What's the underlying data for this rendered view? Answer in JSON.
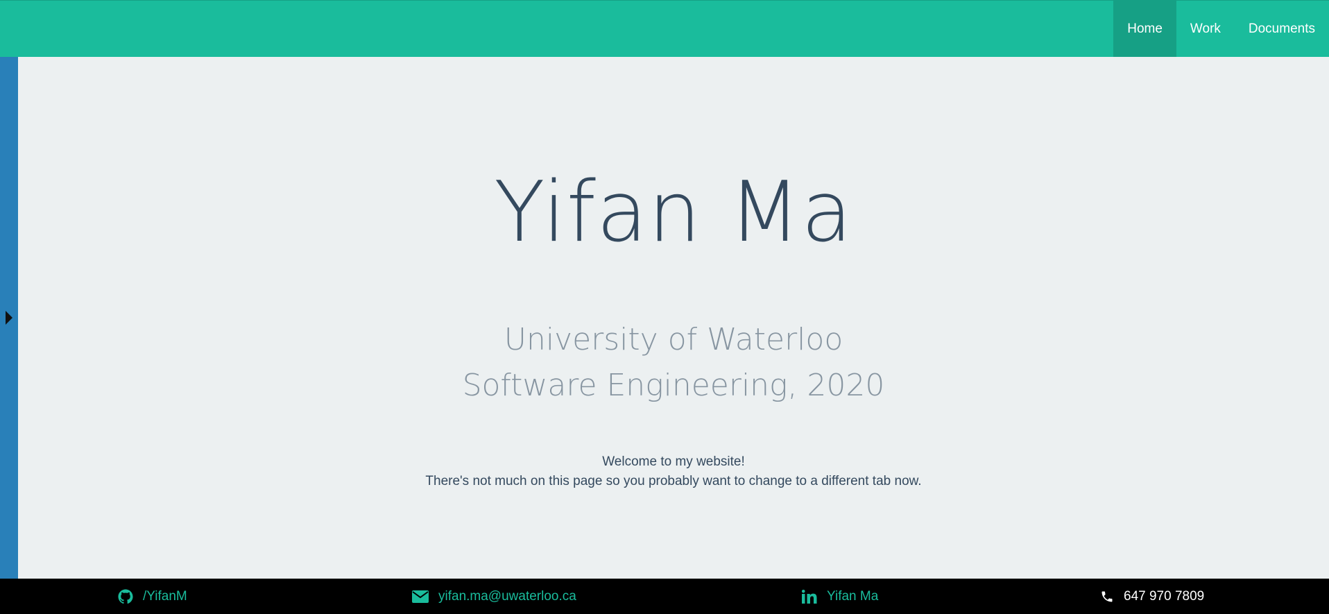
{
  "nav": {
    "links": [
      {
        "label": "Home",
        "active": true
      },
      {
        "label": "Work",
        "active": false
      },
      {
        "label": "Documents",
        "active": false
      }
    ]
  },
  "sidebar": {
    "toggle_icon": "caret-right-icon"
  },
  "hero": {
    "name": "Yifan Ma",
    "school": "University of Waterloo",
    "program": "Software Engineering, 2020",
    "welcome_line1": "Welcome to my website!",
    "welcome_line2": "There's not much on this page so you probably want to change to a different tab now."
  },
  "footer": {
    "github": {
      "icon": "github-icon",
      "label": "/YifanM"
    },
    "email": {
      "icon": "envelope-icon",
      "label": "yifan.ma@uwaterloo.ca"
    },
    "linkedin": {
      "icon": "linkedin-icon",
      "label": "Yifan Ma"
    },
    "phone": {
      "icon": "phone-icon",
      "label": "647 970 7809"
    }
  },
  "colors": {
    "navbar": "#1abc9c",
    "navbar_active": "#16a085",
    "sidebar": "#2980b9",
    "background": "#ecf0f1",
    "heading": "#34495e",
    "footer": "#000000"
  }
}
